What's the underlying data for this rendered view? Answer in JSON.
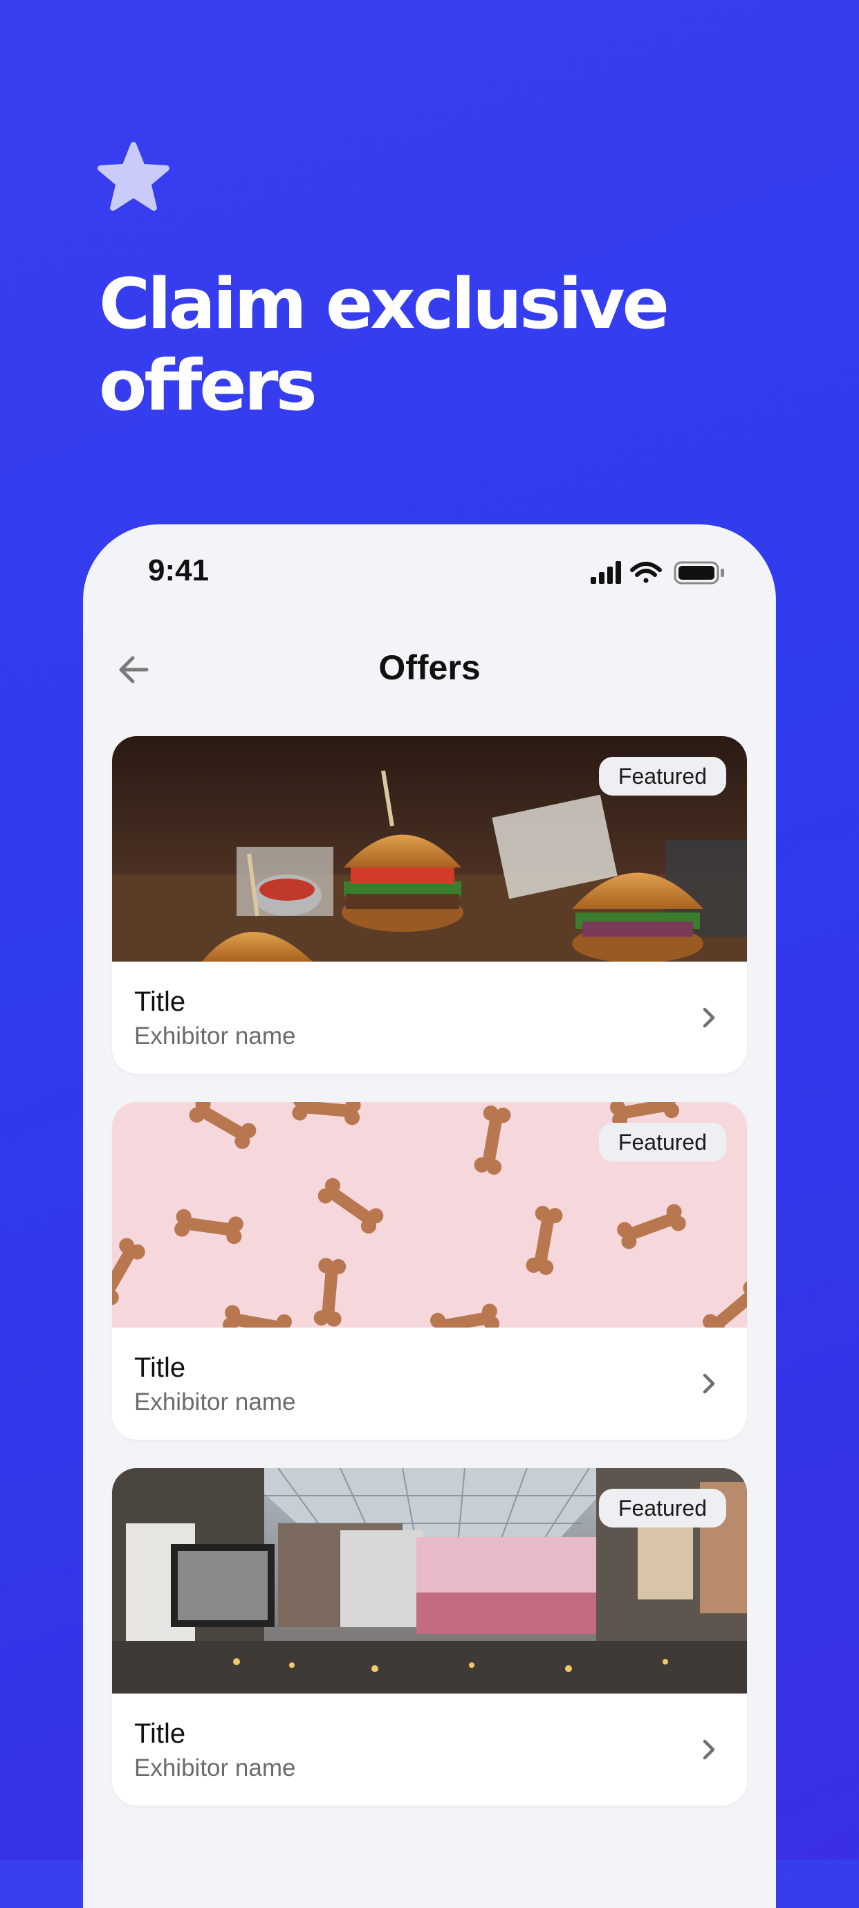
{
  "hero": {
    "icon": "star-icon",
    "title_line1": "Claim exclusive",
    "title_line2": "offers"
  },
  "status_bar": {
    "time": "9:41",
    "icons": [
      "signal-icon",
      "wifi-icon",
      "battery-icon"
    ]
  },
  "nav": {
    "back_icon": "arrow-left-icon",
    "title": "Offers"
  },
  "offers": [
    {
      "badge": "Featured",
      "title": "Title",
      "exhibitor": "Exhibitor name",
      "image": "burgers-photo"
    },
    {
      "badge": "Featured",
      "title": "Title",
      "exhibitor": "Exhibitor name",
      "image": "dog-biscuits-photo"
    },
    {
      "badge": "Featured",
      "title": "Title",
      "exhibitor": "Exhibitor name",
      "image": "shopping-mall-photo"
    }
  ],
  "colors": {
    "background": "#3139ec",
    "phone_surface": "#f3f4f7",
    "card": "#ffffff",
    "badge": "#eeeff2",
    "star": "#c9ccf9"
  }
}
